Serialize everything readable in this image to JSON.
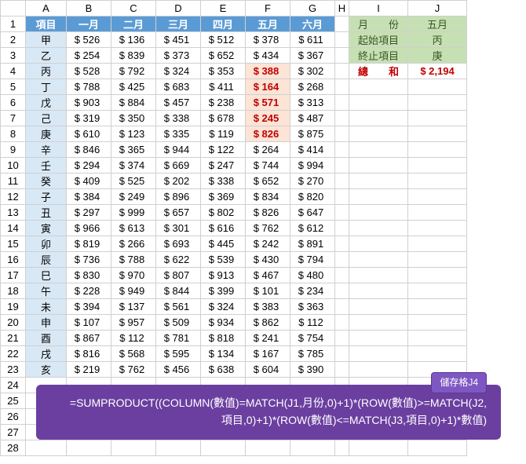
{
  "cols": [
    "A",
    "B",
    "C",
    "D",
    "E",
    "F",
    "G",
    "H",
    "I",
    "J"
  ],
  "headers": [
    "項目",
    "一月",
    "二月",
    "三月",
    "四月",
    "五月",
    "六月"
  ],
  "rows": [
    {
      "label": "甲",
      "vals": [
        "$  526",
        "$  136",
        "$  451",
        "$  512",
        "$  378",
        "$  611"
      ]
    },
    {
      "label": "乙",
      "vals": [
        "$  254",
        "$  839",
        "$  373",
        "$  652",
        "$  434",
        "$  367"
      ]
    },
    {
      "label": "丙",
      "vals": [
        "$  528",
        "$  792",
        "$  324",
        "$  353",
        "$  388",
        "$  302"
      ],
      "hl": 4
    },
    {
      "label": "丁",
      "vals": [
        "$  788",
        "$  425",
        "$  683",
        "$  411",
        "$  164",
        "$  268"
      ],
      "hl": 4
    },
    {
      "label": "戊",
      "vals": [
        "$  903",
        "$  884",
        "$  457",
        "$  238",
        "$  571",
        "$  313"
      ],
      "hl": 4
    },
    {
      "label": "己",
      "vals": [
        "$  319",
        "$  350",
        "$  338",
        "$  678",
        "$  245",
        "$  487"
      ],
      "hl": 4
    },
    {
      "label": "庚",
      "vals": [
        "$  610",
        "$  123",
        "$  335",
        "$  119",
        "$  826",
        "$  875"
      ],
      "hl": 4
    },
    {
      "label": "辛",
      "vals": [
        "$  846",
        "$  365",
        "$  944",
        "$  122",
        "$  264",
        "$  414"
      ]
    },
    {
      "label": "壬",
      "vals": [
        "$  294",
        "$  374",
        "$  669",
        "$  247",
        "$  744",
        "$  994"
      ]
    },
    {
      "label": "癸",
      "vals": [
        "$  409",
        "$  525",
        "$  202",
        "$  338",
        "$  652",
        "$  270"
      ]
    },
    {
      "label": "子",
      "vals": [
        "$  384",
        "$  249",
        "$  896",
        "$  369",
        "$  834",
        "$  820"
      ]
    },
    {
      "label": "丑",
      "vals": [
        "$  297",
        "$  999",
        "$  657",
        "$  802",
        "$  826",
        "$  647"
      ]
    },
    {
      "label": "寅",
      "vals": [
        "$  966",
        "$  613",
        "$  301",
        "$  616",
        "$  762",
        "$  612"
      ]
    },
    {
      "label": "卯",
      "vals": [
        "$  819",
        "$  266",
        "$  693",
        "$  445",
        "$  242",
        "$  891"
      ]
    },
    {
      "label": "辰",
      "vals": [
        "$  736",
        "$  788",
        "$  622",
        "$  539",
        "$  430",
        "$  794"
      ]
    },
    {
      "label": "巳",
      "vals": [
        "$  830",
        "$  970",
        "$  807",
        "$  913",
        "$  467",
        "$  480"
      ]
    },
    {
      "label": "午",
      "vals": [
        "$  228",
        "$  949",
        "$  844",
        "$  399",
        "$  101",
        "$  234"
      ]
    },
    {
      "label": "未",
      "vals": [
        "$  394",
        "$  137",
        "$  561",
        "$  324",
        "$  383",
        "$  363"
      ]
    },
    {
      "label": "申",
      "vals": [
        "$  107",
        "$  957",
        "$  509",
        "$  934",
        "$  862",
        "$  112"
      ]
    },
    {
      "label": "酉",
      "vals": [
        "$  867",
        "$  112",
        "$  781",
        "$  818",
        "$  241",
        "$  754"
      ]
    },
    {
      "label": "戌",
      "vals": [
        "$  816",
        "$  568",
        "$  595",
        "$  134",
        "$  167",
        "$  785"
      ]
    },
    {
      "label": "亥",
      "vals": [
        "$  219",
        "$  762",
        "$  456",
        "$  638",
        "$  604",
        "$  390"
      ]
    }
  ],
  "side": {
    "month_label": "月　　份",
    "month_val": "五月",
    "start_label": "起始項目",
    "start_val": "丙",
    "end_label": "終止項目",
    "end_val": "庚",
    "sum_label": "總　　和",
    "sum_val": "$ 2,194"
  },
  "formula": {
    "tag": "儲存格J4",
    "line1": "=SUMPRODUCT((COLUMN(數值)=MATCH(J1,月份,0)+1)*(ROW(數值)>=MATCH(J2,",
    "line2": "項目,0)+1)*(ROW(數值)<=MATCH(J3,項目,0)+1)*數值)"
  },
  "chart_data": {
    "type": "table",
    "title": "Monthly values by item with SUMPRODUCT range lookup",
    "categories": [
      "一月",
      "二月",
      "三月",
      "四月",
      "五月",
      "六月"
    ],
    "items": [
      "甲",
      "乙",
      "丙",
      "丁",
      "戊",
      "己",
      "庚",
      "辛",
      "壬",
      "癸",
      "子",
      "丑",
      "寅",
      "卯",
      "辰",
      "巳",
      "午",
      "未",
      "申",
      "酉",
      "戌",
      "亥"
    ],
    "values": [
      [
        526,
        136,
        451,
        512,
        378,
        611
      ],
      [
        254,
        839,
        373,
        652,
        434,
        367
      ],
      [
        528,
        792,
        324,
        353,
        388,
        302
      ],
      [
        788,
        425,
        683,
        411,
        164,
        268
      ],
      [
        903,
        884,
        457,
        238,
        571,
        313
      ],
      [
        319,
        350,
        338,
        678,
        245,
        487
      ],
      [
        610,
        123,
        335,
        119,
        826,
        875
      ],
      [
        846,
        365,
        944,
        122,
        264,
        414
      ],
      [
        294,
        374,
        669,
        247,
        744,
        994
      ],
      [
        409,
        525,
        202,
        338,
        652,
        270
      ],
      [
        384,
        249,
        896,
        369,
        834,
        820
      ],
      [
        297,
        999,
        657,
        802,
        826,
        647
      ],
      [
        966,
        613,
        301,
        616,
        762,
        612
      ],
      [
        819,
        266,
        693,
        445,
        242,
        891
      ],
      [
        736,
        788,
        622,
        539,
        430,
        794
      ],
      [
        830,
        970,
        807,
        913,
        467,
        480
      ],
      [
        228,
        949,
        844,
        399,
        101,
        234
      ],
      [
        394,
        137,
        561,
        324,
        383,
        363
      ],
      [
        107,
        957,
        509,
        934,
        862,
        112
      ],
      [
        867,
        112,
        781,
        818,
        241,
        754
      ],
      [
        816,
        568,
        595,
        134,
        167,
        785
      ],
      [
        219,
        762,
        456,
        638,
        604,
        390
      ]
    ],
    "lookup": {
      "month": "五月",
      "start_item": "丙",
      "end_item": "庚",
      "sum": 2194
    }
  }
}
